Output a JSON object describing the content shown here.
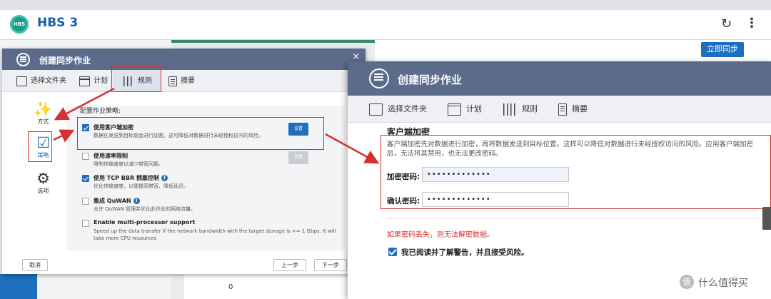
{
  "app": {
    "title": "HBS 3",
    "logo_text": "HBS",
    "sync_now_label": "立即同步",
    "bg_value": "0"
  },
  "left_dialog": {
    "title": "创建同步作业",
    "close": "×",
    "steps": [
      {
        "label": "选择文件夹",
        "icon": "folder-icon"
      },
      {
        "label": "计划",
        "icon": "calendar-icon"
      },
      {
        "label": "规则",
        "icon": "rules-icon"
      },
      {
        "label": "摘要",
        "icon": "summary-icon"
      }
    ],
    "nav": [
      {
        "label": "方式",
        "icon": "magic-wand-icon",
        "glyph": "✨"
      },
      {
        "label": "策略",
        "icon": "clipboard-check-icon",
        "glyph": "📋"
      },
      {
        "label": "选项",
        "icon": "gear-icon",
        "glyph": "⚙"
      }
    ],
    "config_title": "配置作业策略:",
    "options": [
      {
        "name": "使用客户端加密",
        "desc": "数据在发送到目标前会进行加密。这可降低对数据进行未经授权访问的风险。",
        "checked": true,
        "button": "设置"
      },
      {
        "name": "使用速率限制",
        "desc": "限制传输速度以减少带宽问题。",
        "checked": false,
        "button": "设置"
      },
      {
        "name": "使用 TCP BBR 拥塞控制",
        "desc": "优化传输速度，以便提高带宽、降低延迟。",
        "checked": true
      },
      {
        "name": "集成 QuWAN",
        "desc": "允许 QuWAN 管理并优化此作业的网络流量。",
        "checked": false
      },
      {
        "name": "Enable multi-processor support",
        "desc": "Speed up the data transfer if the network bandwidth with the target storage is >= 1 Gbps. It will take more CPU resources",
        "checked": false
      }
    ],
    "cancel_label": "取消",
    "prev_label": "上一步",
    "next_label": "下一步"
  },
  "right_dialog": {
    "title": "创建同步作业",
    "steps": [
      {
        "label": "选择文件夹",
        "icon": "folder-icon"
      },
      {
        "label": "计划",
        "icon": "calendar-icon"
      },
      {
        "label": "规则",
        "icon": "rules-icon"
      },
      {
        "label": "摘要",
        "icon": "summary-icon"
      }
    ],
    "section_title": "客户端加密",
    "section_desc": "客户端加密先对数据进行加密，再将数据发送到目标位置。这样可以降低对数据进行未经授权访问的风险。应用客户端加密后，无法将其禁用，也无法更改密码。",
    "password_label": "加密密码:",
    "password_value": "•••••••••••••",
    "confirm_label": "确认密码:",
    "confirm_value": "•••••••••••••",
    "warning": "如果密码丢失，则无法解密数据。",
    "ack_label": "我已阅读并了解警告，并且接受风险。"
  },
  "watermark": {
    "badge": "值",
    "text": "什么值得买"
  },
  "colors": {
    "accent": "#1e6fbe",
    "titlebar": "#5b6b8a",
    "annotation_red": "#d63031",
    "warning_red": "#d63031"
  }
}
